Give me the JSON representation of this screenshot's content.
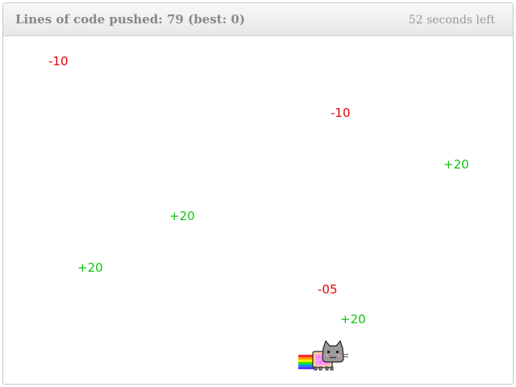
{
  "header": {
    "score_label": "Lines of code pushed:",
    "score_value": "79",
    "best_label": "(best:",
    "best_value": "0",
    "best_close": ")",
    "time_value": "52",
    "time_label": "seconds left"
  },
  "items": [
    {
      "text": "-10",
      "kind": "neg"
    },
    {
      "text": "-10",
      "kind": "neg"
    },
    {
      "text": "+20",
      "kind": "pos"
    },
    {
      "text": "+20",
      "kind": "pos"
    },
    {
      "text": "+20",
      "kind": "pos"
    },
    {
      "text": "-05",
      "kind": "neg"
    },
    {
      "text": "+20",
      "kind": "pos"
    }
  ],
  "player": {
    "icon": "nyan-cat-icon"
  },
  "colors": {
    "negative": "#e60000",
    "positive": "#12c212",
    "header_text": "#888888"
  }
}
